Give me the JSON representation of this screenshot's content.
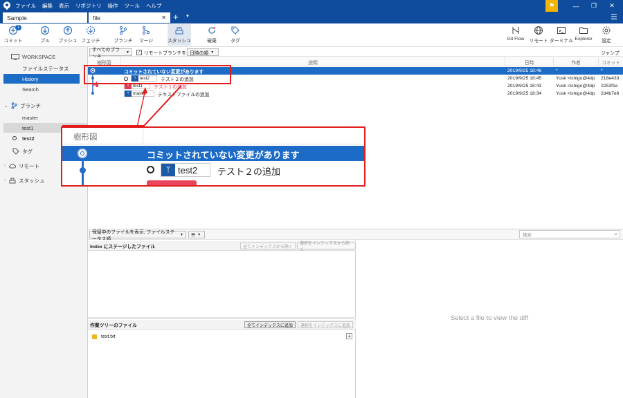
{
  "titlebar": {
    "menu": [
      "ファイル",
      "編集",
      "表示",
      "リポジトリ",
      "操作",
      "ツール",
      "ヘルプ"
    ],
    "flag_icon": "flag-icon"
  },
  "tabs": [
    {
      "label": "Sample"
    },
    {
      "label": "file"
    }
  ],
  "toolbar": {
    "left": [
      {
        "label": "コミット",
        "icon": "commit-icon",
        "badge": "1"
      },
      {
        "label": "プル",
        "icon": "pull-icon"
      },
      {
        "label": "プッシュ",
        "icon": "push-icon"
      },
      {
        "label": "フェッチ",
        "icon": "fetch-icon"
      },
      {
        "label": "ブランチ",
        "icon": "branch-icon"
      },
      {
        "label": "マージ",
        "icon": "merge-icon"
      },
      {
        "label": "スタッシュ",
        "icon": "stash-icon"
      },
      {
        "label": "破棄",
        "icon": "discard-icon"
      },
      {
        "label": "タグ",
        "icon": "tag-icon"
      }
    ],
    "right": [
      {
        "label": "Git Flow",
        "icon": "gitflow-icon"
      },
      {
        "label": "リモート",
        "icon": "globe-icon"
      },
      {
        "label": "ターミナル",
        "icon": "terminal-icon"
      },
      {
        "label": "Explorer",
        "icon": "folder-icon"
      },
      {
        "label": "設定",
        "icon": "gear-icon"
      }
    ]
  },
  "sidebar": {
    "workspace": "WORKSPACE",
    "file_status": "ファイルステータス",
    "history": "History",
    "search": "Search",
    "branches": "ブランチ",
    "branch_items": [
      "master",
      "test1",
      "test2"
    ],
    "tags": "タグ",
    "remotes": "リモート",
    "stashes": "スタッシュ"
  },
  "history_toolbar": {
    "branch_filter": "すべてのブランチ",
    "show_remote": "リモートブランチを表示",
    "sort": "日時の順",
    "jump": "ジャンプ先:"
  },
  "columns": {
    "graph": "樹形図",
    "description": "説明",
    "date": "日時",
    "author": "作者",
    "commit": "コミット"
  },
  "commits": [
    {
      "branch": "",
      "desc": "コミットされていない変更があります",
      "date": "2019/9/25  18:46",
      "author": "*",
      "hash": "*"
    },
    {
      "branch": "test2",
      "desc": "テスト２の追加",
      "date": "2019/9/25  18:45",
      "author": "Yusk <ishigo@4dp",
      "hash": "218e433"
    },
    {
      "branch": "test1",
      "desc": "テスト１の追加",
      "date": "2019/9/25  18:43",
      "author": "Yusk <ishigo@4dp",
      "hash": "2253f1e"
    },
    {
      "branch": "master",
      "desc": "テキストファイルの追加",
      "date": "2019/9/25  18:34",
      "author": "Yusk <ishigo@4dp",
      "hash": "2d4b7e6"
    }
  ],
  "file_panel": {
    "view_mode": "保留中のファイルを表示, ファイルステータス順",
    "search_placeholder": "検索",
    "staged_title": "Index にステージしたファイル",
    "unstage_all": "全てインデックスから除く",
    "unstage_selected": "選択をインデックスから除く",
    "working_title": "作業ツリーのファイル",
    "stage_all": "全てインデックスに追加",
    "stage_selected": "選択をインデックスに追加",
    "working_files": [
      "text.txt"
    ],
    "diff_placeholder": "Select a file to view the diff"
  },
  "zoom": {
    "header": "樹形図",
    "row1": "コミットされていない変更があります",
    "row2_branch": "test2",
    "row2_desc": "テスト２の追加"
  },
  "colors": {
    "accent": "#1c6bc6",
    "titlebar": "#0f4c9e",
    "callout": "#e11d1d",
    "graph_blue": "#2a6bc4",
    "graph_red": "#e53950"
  }
}
